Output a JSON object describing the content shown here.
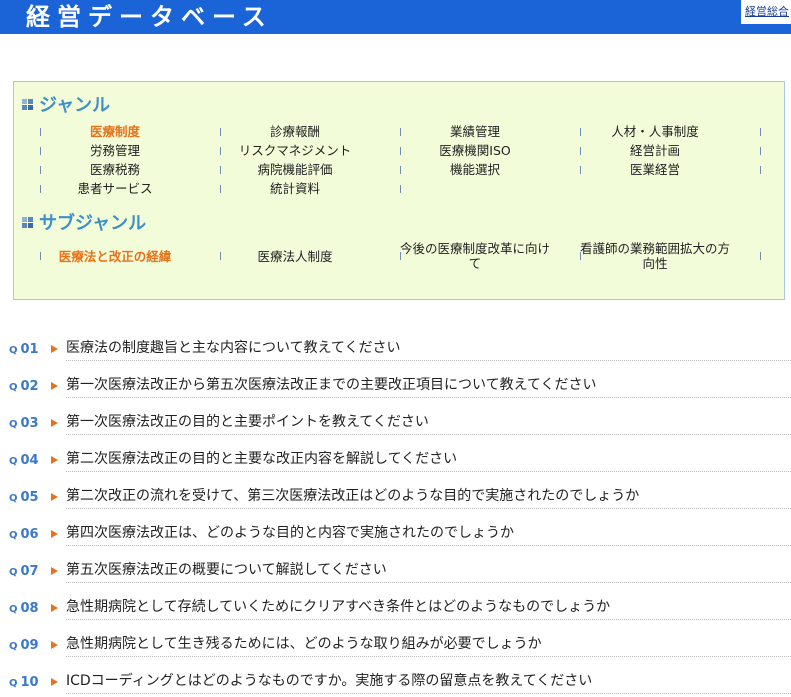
{
  "header": {
    "title": "経営データベース",
    "link": "経営総合"
  },
  "genre": {
    "heading": "ジャンル",
    "items": [
      [
        "医療制度",
        "診療報酬",
        "業績管理",
        "人材・人事制度"
      ],
      [
        "労務管理",
        "リスクマネジメント",
        "医療機関ISO",
        "経営計画"
      ],
      [
        "医療税務",
        "病院機能評価",
        "機能選択",
        "医業経営"
      ],
      [
        "患者サービス",
        "統計資料"
      ]
    ]
  },
  "subgenre": {
    "heading": "サブジャンル",
    "items": [
      "医療法と改正の経緯",
      "医療法人制度",
      "今後の医療制度改革に向けて",
      "看護師の業務範囲拡大の方向性"
    ]
  },
  "questions": [
    {
      "num": "01",
      "text": "医療法の制度趣旨と主な内容について教えてください"
    },
    {
      "num": "02",
      "text": "第一次医療法改正から第五次医療法改正までの主要改正項目について教えてください"
    },
    {
      "num": "03",
      "text": "第一次医療法改正の目的と主要ポイントを教えてください"
    },
    {
      "num": "04",
      "text": "第二次医療法改正の目的と主要な改正内容を解説してください"
    },
    {
      "num": "05",
      "text": "第二次改正の流れを受けて、第三次医療法改正はどのような目的で実施されたのでしょうか"
    },
    {
      "num": "06",
      "text": "第四次医療法改正は、どのような目的と内容で実施されたのでしょうか"
    },
    {
      "num": "07",
      "text": "第五次医療法改正の概要について解説してください"
    },
    {
      "num": "08",
      "text": "急性期病院として存続していくためにクリアすべき条件とはどのようなものでしょうか"
    },
    {
      "num": "09",
      "text": "急性期病院として生き残るためには、どのような取り組みが必要でしょうか"
    },
    {
      "num": "10",
      "text": "ICDコーディングとはどのようなものですか。実施する際の留意点を教えてください"
    }
  ],
  "q_prefix": "Q",
  "colors": {
    "header": "#1a64d8",
    "accent": "#e8721a",
    "heading": "#3f8fc9",
    "panel": "#f2fcd9"
  }
}
